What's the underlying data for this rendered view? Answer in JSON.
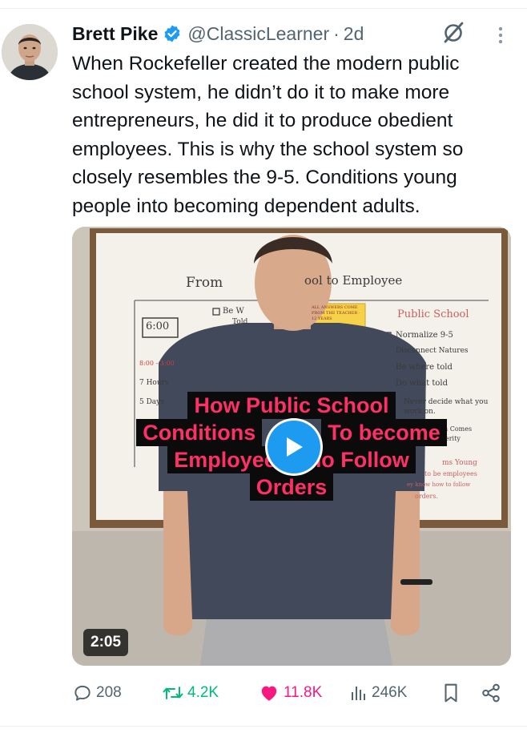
{
  "post": {
    "author": {
      "name": "Brett Pike",
      "handle": "@ClassicLearner",
      "separator": "·",
      "time": "2d",
      "verified": true
    },
    "text": "When Rockefeller created the modern public school system, he didn’t do it to make more entrepreneurs, he did it to produce obedient employees. This is why the school system so closely resembles the 9-5. Conditions young people into becoming dependent adults.",
    "video": {
      "caption_lines": [
        "How Public School",
        "Conditions",
        "To become",
        "Employee",
        "ho Follow",
        "Orders"
      ],
      "duration": "2:05",
      "whiteboard": {
        "title_left": "From",
        "title_right": "ool to Employee",
        "box_time": "6:00",
        "left_notes": [
          "8:00 - 3:00",
          "7 Hours",
          "5 Days"
        ],
        "middle_items": [
          "Be W",
          "Told"
        ],
        "sticky_note": "ALL ANSWERS COME FROM THE TEACHER · 12 YEARS",
        "public_school_header": "Public School",
        "checklist": [
          "Normalize 9-5",
          "Disconnect Natures",
          "Be where told",
          "Do what told"
        ],
        "extra_notes": [
          "Never decide what you",
          "work on.",
          "n Comes",
          "erity",
          "ms Young",
          "to be employees",
          "ey know how to follow",
          "orders."
        ]
      }
    },
    "actions": {
      "replies": "208",
      "reposts": "4.2K",
      "likes": "11.8K",
      "views": "246K"
    },
    "colors": {
      "text": "#0f1419",
      "secondary": "#536471",
      "verified": "#1d9bf0",
      "repost": "#00ba7c",
      "like": "#f91880",
      "caption_text": "#ff2f68",
      "caption_bg": "#0b0b0b"
    },
    "icons": [
      "verified-badge-icon",
      "grok-icon",
      "more-icon",
      "reply-icon",
      "repost-icon",
      "like-icon",
      "views-icon",
      "bookmark-icon",
      "share-icon",
      "play-icon"
    ]
  }
}
